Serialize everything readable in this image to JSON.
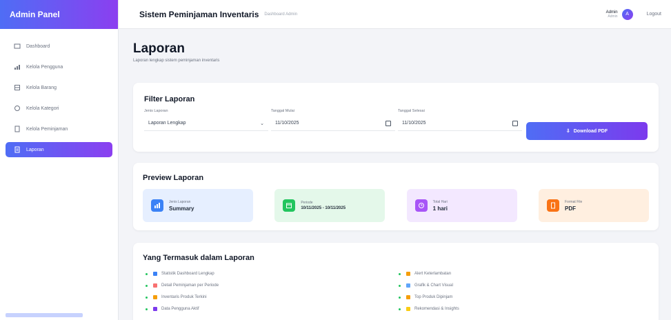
{
  "sidebar": {
    "brand": "Admin Panel",
    "items": [
      {
        "label": "Dashboard",
        "icon": "dashboard-icon",
        "active": false
      },
      {
        "label": "Kelola Pengguna",
        "icon": "users-icon",
        "active": false
      },
      {
        "label": "Kelola Barang",
        "icon": "box-icon",
        "active": false
      },
      {
        "label": "Kelola Kategori",
        "icon": "tag-icon",
        "active": false
      },
      {
        "label": "Kelola Peminjaman",
        "icon": "clipboard-icon",
        "active": false
      },
      {
        "label": "Laporan",
        "icon": "report-icon",
        "active": true
      }
    ]
  },
  "header": {
    "title": "Sistem Peminjaman Inventaris",
    "subtitle": "Dashboard Admin",
    "user_name": "Admin",
    "user_role": "Admin",
    "avatar_initial": "A",
    "logout": "Logout"
  },
  "page": {
    "title": "Laporan",
    "subtitle": "Laporan lengkap sistem peminjaman inventaris"
  },
  "filter": {
    "title": "Filter Laporan",
    "jenis_label": "Jenis Laporan",
    "jenis_value": "Laporan Lengkap",
    "mulai_label": "Tanggal Mulai",
    "mulai_value": "11/10/2025",
    "selesai_label": "Tanggal Selesai",
    "selesai_value": "11/10/2025",
    "download_label": "Download PDF"
  },
  "preview": {
    "title": "Preview Laporan",
    "stats": [
      {
        "label": "Jenis Laporan",
        "value": "Summary",
        "color": "#3b82f6",
        "icon": "chart-icon"
      },
      {
        "label": "Periode",
        "value": "10/11/2025 - 10/11/2025",
        "color": "#22c55e",
        "icon": "calendar-icon"
      },
      {
        "label": "Total Hari",
        "value": "1 hari",
        "color": "#a855f7",
        "icon": "clock-icon"
      },
      {
        "label": "Format File",
        "value": "PDF",
        "color": "#f97316",
        "icon": "file-icon"
      }
    ]
  },
  "includes": {
    "title": "Yang Termasuk dalam Laporan",
    "left": [
      {
        "label": "Statistik Dashboard Lengkap",
        "icon": "stats-icon",
        "color": "#3b82f6"
      },
      {
        "label": "Detail Peminjaman per Periode",
        "icon": "list-icon",
        "color": "#f87171"
      },
      {
        "label": "Inventaris Produk Terkini",
        "icon": "box-icon",
        "color": "#f59e0b"
      },
      {
        "label": "Data Pengguna Aktif",
        "icon": "users-icon",
        "color": "#7c3aed"
      }
    ],
    "right": [
      {
        "label": "Alert Keterlambatan",
        "icon": "alert-icon",
        "color": "#f59e0b"
      },
      {
        "label": "Grafik & Chart Visual",
        "icon": "chart-icon",
        "color": "#60a5fa"
      },
      {
        "label": "Top Produk Dipinjam",
        "icon": "trophy-icon",
        "color": "#f59e0b"
      },
      {
        "label": "Rekomendasi & Insights",
        "icon": "bulb-icon",
        "color": "#facc15"
      }
    ]
  }
}
